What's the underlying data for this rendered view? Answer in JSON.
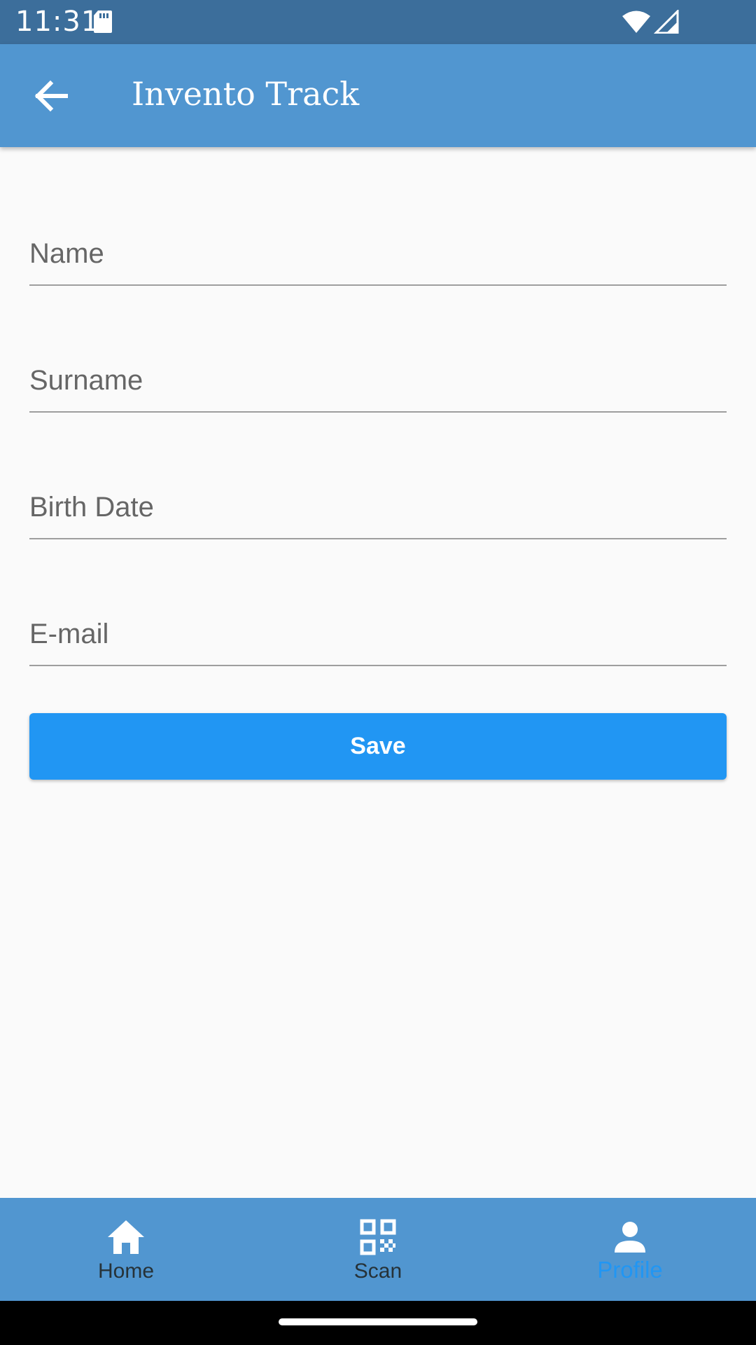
{
  "status_bar": {
    "time": "11:31"
  },
  "app_bar": {
    "title": "Invento Track"
  },
  "form": {
    "fields": [
      {
        "label": "Name",
        "value": ""
      },
      {
        "label": "Surname",
        "value": ""
      },
      {
        "label": "Birth Date",
        "value": ""
      },
      {
        "label": "E-mail",
        "value": ""
      }
    ],
    "save_label": "Save"
  },
  "bottom_nav": {
    "items": [
      {
        "label": "Home",
        "icon": "home-icon"
      },
      {
        "label": "Scan",
        "icon": "qr-code-icon"
      },
      {
        "label": "Profile",
        "icon": "person-icon"
      }
    ],
    "active": "Profile"
  },
  "colors": {
    "status_bar": "#3c6e9b",
    "app_bar": "#5196d0",
    "primary": "#2196f3",
    "background": "#fafafa"
  }
}
